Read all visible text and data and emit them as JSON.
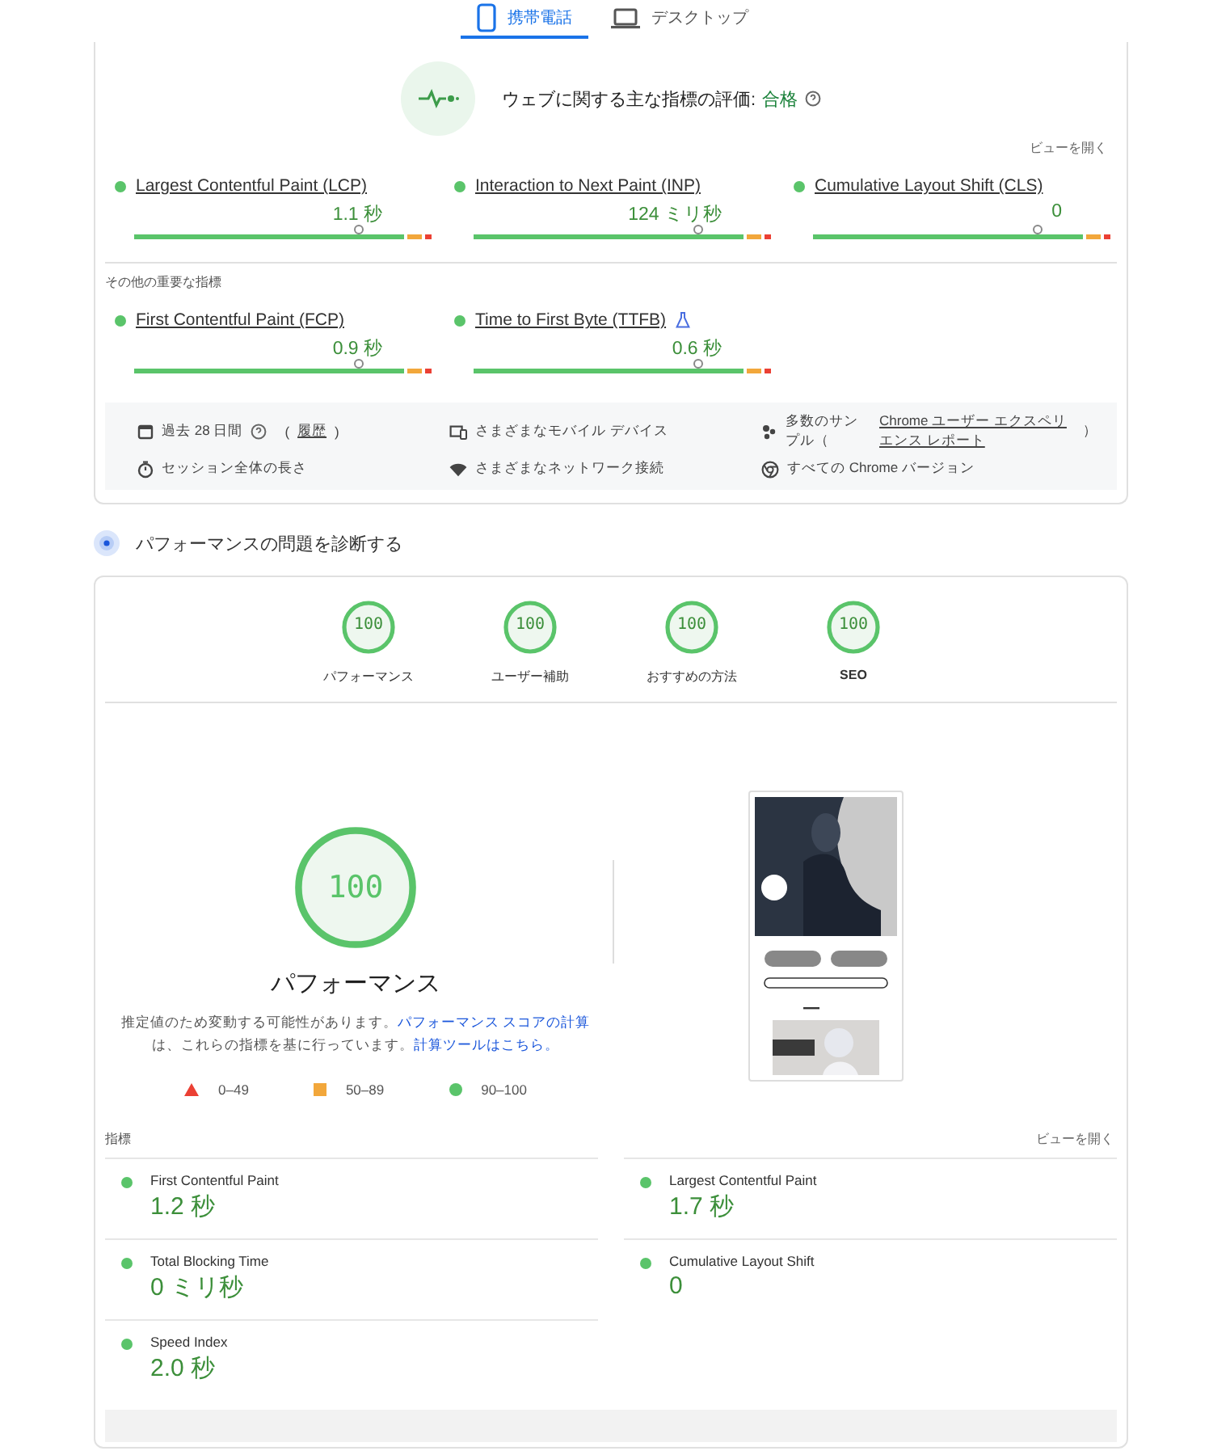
{
  "tabs": [
    {
      "label": "携帯電話",
      "kind": "phone",
      "selected": true
    },
    {
      "label": "デスクトップ",
      "kind": "laptop",
      "selected": false
    }
  ],
  "field": {
    "title": "ウェブに関する主な指標の評価:",
    "verdict": "合格",
    "expand_link": "ビューを開く",
    "core_metrics": [
      {
        "name": "Largest Contentful Paint (LCP)",
        "value": "1.1 秒",
        "level": 0.75,
        "experimental": false
      },
      {
        "name": "Interaction to Next Paint (INP)",
        "value": "124 ミリ秒",
        "level": 0.75,
        "experimental": false
      },
      {
        "name": "Cumulative Layout Shift (CLS)",
        "value": "0",
        "level": 0.75,
        "experimental": false
      }
    ],
    "other_heading": "その他の重要な指標",
    "other_metrics": [
      {
        "name": "First Contentful Paint (FCP)",
        "value": "0.9 秒",
        "level": 0.75,
        "experimental": false
      },
      {
        "name": "Time to First Byte (TTFB)",
        "value": "0.6 秒",
        "level": 0.75,
        "experimental": true
      }
    ],
    "info": [
      {
        "kind": "calendar",
        "text": "過去 28 日間",
        "help": true,
        "open": "(",
        "link": "履歴",
        "close": ")"
      },
      {
        "kind": "devices",
        "text": "さまざまなモバイル デバイス",
        "help": false
      },
      {
        "kind": "samples",
        "text": "多数のサンプル（",
        "help": false,
        "link": "Chrome ユーザー エクスペリエンス レポート",
        "close": "）"
      },
      {
        "kind": "timer",
        "text": "セッション全体の長さ",
        "help": false
      },
      {
        "kind": "wifi",
        "text": "さまざまなネットワーク接続",
        "help": false
      },
      {
        "kind": "chrome",
        "text": "すべての Chrome バージョン",
        "help": false
      }
    ]
  },
  "lab": {
    "heading": "パフォーマンスの問題を診断する",
    "categories": [
      {
        "score": "100",
        "label": "パフォーマンス"
      },
      {
        "score": "100",
        "label": "ユーザー補助"
      },
      {
        "score": "100",
        "label": "おすすめの方法"
      },
      {
        "score": "100",
        "label": "SEO"
      }
    ],
    "gauge": {
      "score": "100",
      "title": "パフォーマンス"
    },
    "note": {
      "text": "推定値のため変動する可能性があります。",
      "link": "パフォーマンス スコアの計算",
      "text2": "は、これらの指標を基に行っています。",
      "link2": "計算ツールはこちら。"
    },
    "legend": [
      {
        "kind": "triangle",
        "label": "0–49"
      },
      {
        "kind": "square",
        "label": "50–89"
      },
      {
        "kind": "circle",
        "label": "90–100"
      }
    ],
    "metrics_heading": "指標",
    "expand_link": "ビューを開く",
    "metrics": [
      {
        "name": "First Contentful Paint",
        "value": "1.2 秒"
      },
      {
        "name": "Largest Contentful Paint",
        "value": "1.7 秒"
      },
      {
        "name": "Total Blocking Time",
        "value": "0 ミリ秒"
      },
      {
        "name": "Cumulative Layout Shift",
        "value": "0"
      },
      {
        "name": "Speed Index",
        "value": "2.0 秒"
      }
    ]
  }
}
